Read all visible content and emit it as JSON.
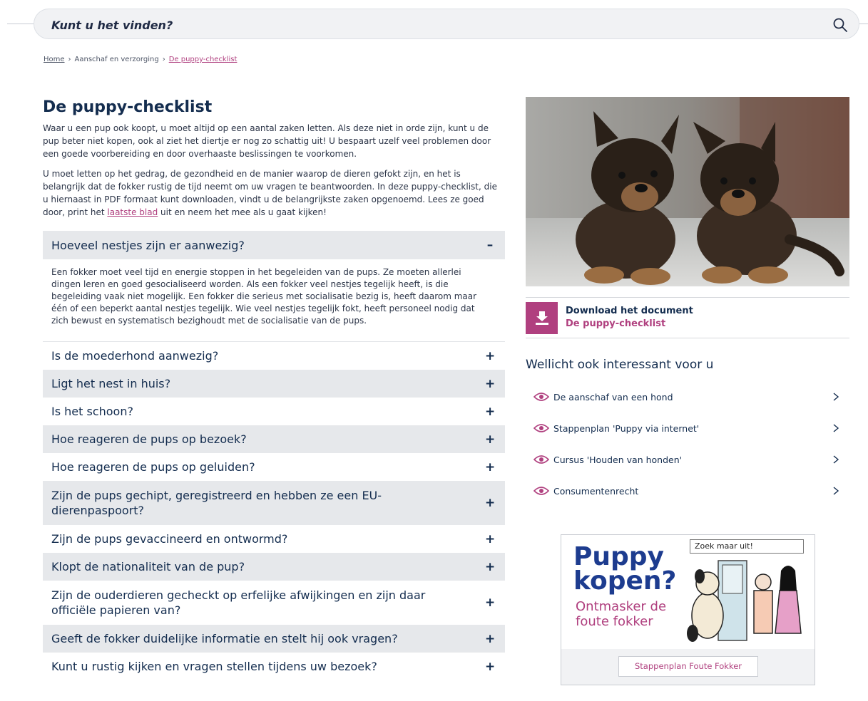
{
  "search": {
    "placeholder": "Kunt u het vinden?"
  },
  "breadcrumb": {
    "home": "Home",
    "sep": "›",
    "middle": "Aanschaf en verzorging",
    "current": "De puppy-checklist"
  },
  "page": {
    "title": "De puppy-checklist",
    "intro_p1": "Waar u een pup ook koopt, u moet altijd op een aantal zaken letten. Als deze niet in orde zijn, kunt u de pup beter niet kopen, ook al ziet het diertje er nog zo schattig uit! U bespaart uzelf veel problemen door een goede voorbereiding en door overhaaste beslissingen te voorkomen.",
    "intro_p2_before": "U moet letten op het gedrag, de gezondheid en de manier waarop de dieren gefokt zijn, en het is belangrijk dat de fokker rustig de tijd neemt om uw vragen te beantwoorden. In deze puppy-checklist, die u hiernaast in PDF formaat kunt downloaden, vindt u de belangrijkste zaken opgenoemd. Lees ze goed door, print het ",
    "intro_p2_link": "laatste blad",
    "intro_p2_after": " uit en neem het mee als u gaat kijken!"
  },
  "accordion": {
    "open_item": {
      "label": "Hoeveel nestjes zijn er aanwezig?",
      "sign": "–",
      "body": "Een fokker moet veel tijd en energie stoppen in het begeleiden van de pups. Ze moeten allerlei dingen leren en goed gesocialiseerd worden. Als een fokker veel nestjes tegelijk heeft, is die begeleiding vaak niet mogelijk. Een fokker die serieus met socialisatie bezig is, heeft daarom maar één of een beperkt aantal nestjes tegelijk. Wie veel nestjes tegelijk fokt, heeft personeel nodig dat zich bewust en systematisch bezighoudt met de socialisatie van de pups."
    },
    "sign_closed": "+",
    "items": [
      "Is de moederhond aanwezig?",
      "Ligt het nest in huis?",
      "Is het schoon?",
      "Hoe reageren de pups op bezoek?",
      "Hoe reageren de pups op geluiden?",
      "Zijn de pups gechipt, geregistreerd en hebben ze een EU-dierenpaspoort?",
      "Zijn de pups gevaccineerd en ontwormd?",
      "Klopt de nationaliteit van de pup?",
      "Zijn de ouderdieren gecheckt op erfelijke afwijkingen en zijn daar officiële papieren van?",
      "Geeft de fokker duidelijke informatie en stelt hij ook vragen?",
      "Kunt u rustig kijken en vragen stellen tijdens uw bezoek?"
    ]
  },
  "download": {
    "line1": "Download het document",
    "line2": "De puppy-checklist"
  },
  "related": {
    "title": "Wellicht ook interessant voor u",
    "items": [
      "De aanschaf van een hond",
      "Stappenplan 'Puppy via internet'",
      "Cursus 'Houden van honden'",
      "Consumentenrecht"
    ]
  },
  "ad": {
    "h1_line1": "Puppy",
    "h1_line2": "kopen?",
    "h2_line1": "Ontmasker de",
    "h2_line2": "foute fokker",
    "bubble": "Zoek maar uit!",
    "button": "Stappenplan Foute Fokker"
  },
  "colors": {
    "accent": "#b0407f",
    "navy": "#142d4f",
    "shade": "#e6e8eb"
  }
}
